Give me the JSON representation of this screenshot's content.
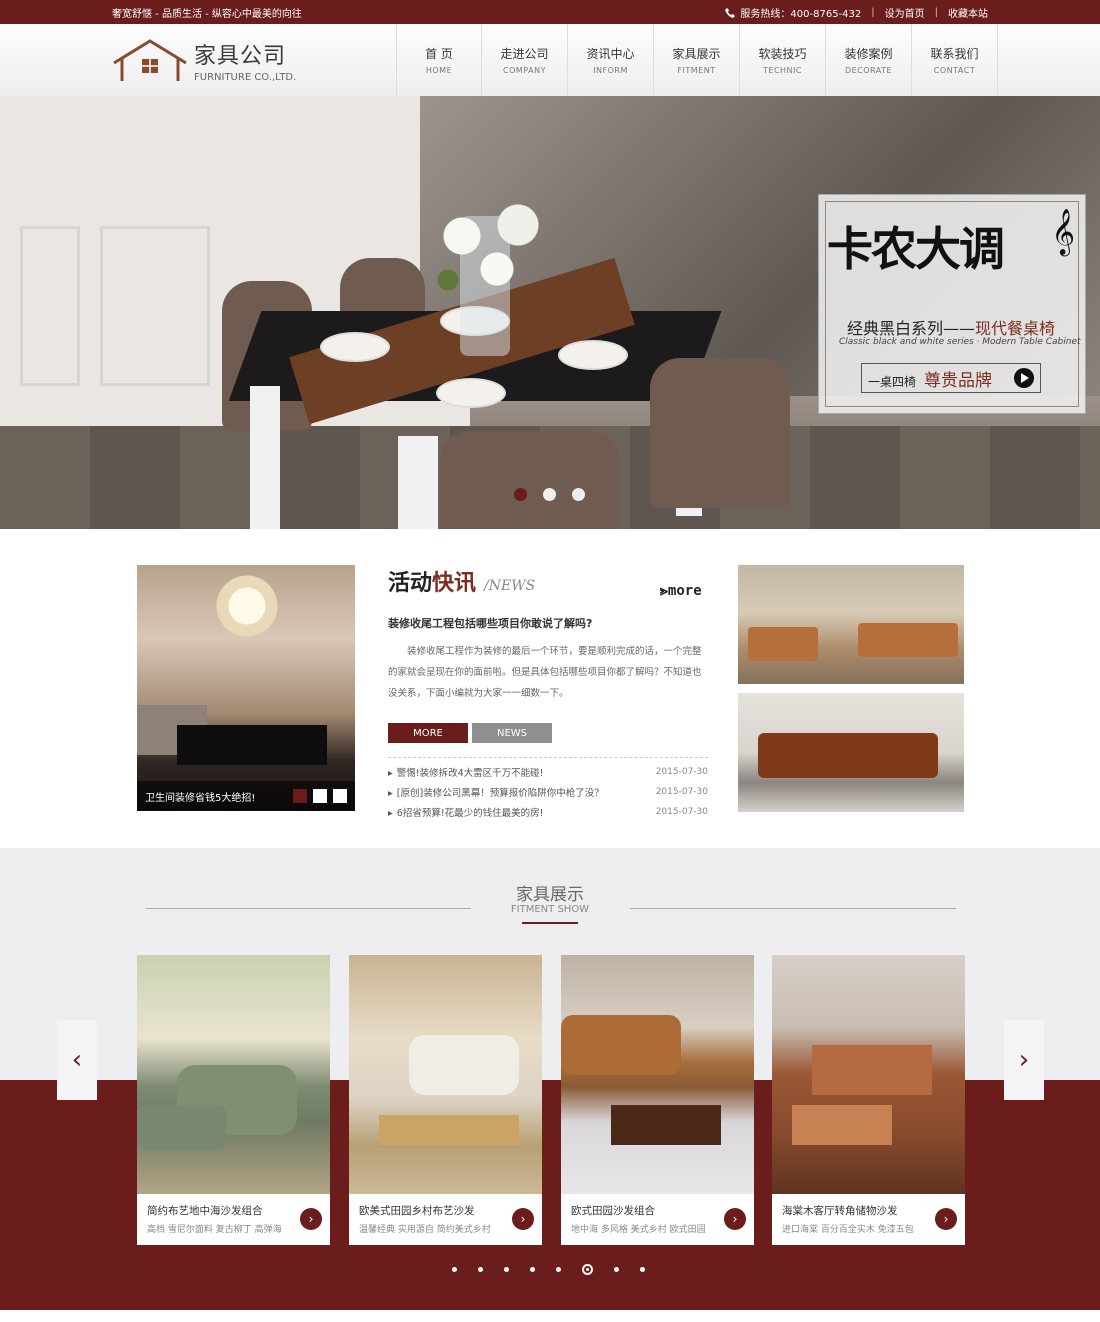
{
  "topbar": {
    "slogan": "奢宽舒惬 - 品质生活 - 纵容心中最美的向往",
    "hotline": "服务热线：400-8765-432",
    "set_home": "设为首页",
    "bookmark": "收藏本站"
  },
  "logo": {
    "cn": "家具公司",
    "en": "FURNITURE CO.,LTD."
  },
  "nav": [
    {
      "cn": "首 页",
      "en": "HOME"
    },
    {
      "cn": "走进公司",
      "en": "COMPANY"
    },
    {
      "cn": "资讯中心",
      "en": "INFORM"
    },
    {
      "cn": "家具展示",
      "en": "FITMENT"
    },
    {
      "cn": "软装技巧",
      "en": "TECHNIC"
    },
    {
      "cn": "装修案例",
      "en": "DECORATE"
    },
    {
      "cn": "联系我们",
      "en": "CONTACT"
    }
  ],
  "banner": {
    "headline": "卡农大调",
    "subtitle_a": "经典黑白系列——",
    "subtitle_b": "现代餐桌椅",
    "script": "Classic black and white series · Modern Table Cabinet",
    "btn_small": "一桌四椅",
    "btn_main": "尊贵品牌",
    "slides": 3,
    "active_slide": 1
  },
  "news": {
    "caption": "卫生间装修省钱5大绝招!",
    "title_a": "活动",
    "title_b": "快讯",
    "title_en": "/NEWS",
    "more": "more",
    "headline": "装修收尾工程包括哪些项目你敢说了解吗?",
    "body": "装修收尾工程作为装修的最后一个环节，要是顺利完成的话，一个完整的家就会呈现在你的面前啦。但是具体包括哪些项目你都了解吗？不知道也没关系，下面小编就为大家一一细数一下。",
    "btn_more": "MORE",
    "btn_news": "NEWS",
    "items": [
      {
        "title": "警惕!装修拆改4大雷区千万不能碰!",
        "date": "2015-07-30"
      },
      {
        "title": "[原创]装修公司黑幕！预算报价陷阱你中枪了没？",
        "date": "2015-07-30"
      },
      {
        "title": "6招省预算!花最少的钱住最美的房!",
        "date": "2015-07-30"
      }
    ]
  },
  "fitment": {
    "title": "家具展示",
    "subtitle": "FITMENT SHOW",
    "cards": [
      {
        "name": "简约布艺地中海沙发组合",
        "tags": "高档 雪尼尔面料 复古柳丁 高弹海"
      },
      {
        "name": "欧美式田园乡村布艺沙发",
        "tags": "温馨经典 实用源自 简约美式乡村"
      },
      {
        "name": "欧式田园沙发组合",
        "tags": "地中海 多风格 美式乡村 欧式田园"
      },
      {
        "name": "海棠木客厅转角储物沙发",
        "tags": "进口海棠 百分百全实木 免漆五包"
      }
    ],
    "dots": 8,
    "active_dot": 6
  },
  "colors": {
    "brand": "#6a1d1a",
    "band": "#eeedef"
  }
}
